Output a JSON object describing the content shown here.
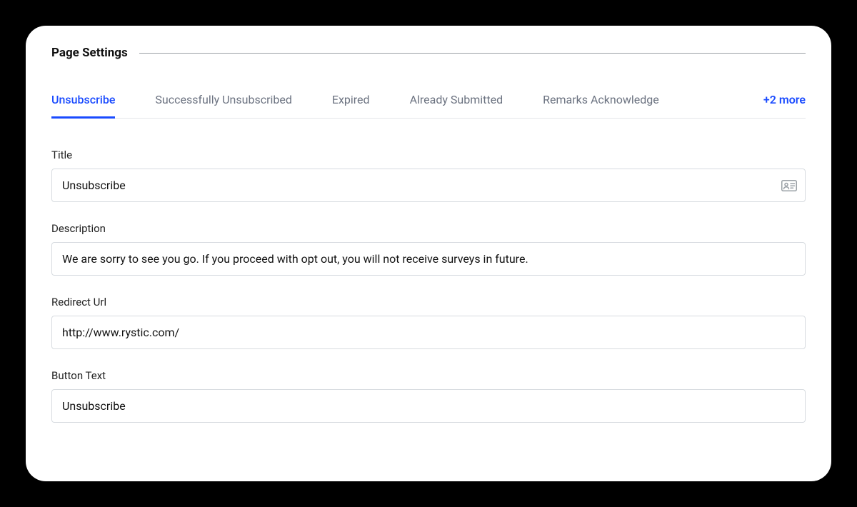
{
  "section": {
    "title": "Page Settings"
  },
  "tabs": {
    "items": [
      {
        "label": "Unsubscribe",
        "active": true
      },
      {
        "label": "Successfully Unsubscribed",
        "active": false
      },
      {
        "label": "Expired",
        "active": false
      },
      {
        "label": "Already Submitted",
        "active": false
      },
      {
        "label": "Remarks Acknowledge",
        "active": false
      }
    ],
    "more_label": "+2 more"
  },
  "fields": {
    "title": {
      "label": "Title",
      "value": "Unsubscribe"
    },
    "description": {
      "label": "Description",
      "value": "We are sorry to see you go. If you proceed with opt out, you will not receive surveys in future."
    },
    "redirect_url": {
      "label": "Redirect Url",
      "value": "http://www.rystic.com/"
    },
    "button_text": {
      "label": "Button Text",
      "value": "Unsubscribe"
    }
  }
}
